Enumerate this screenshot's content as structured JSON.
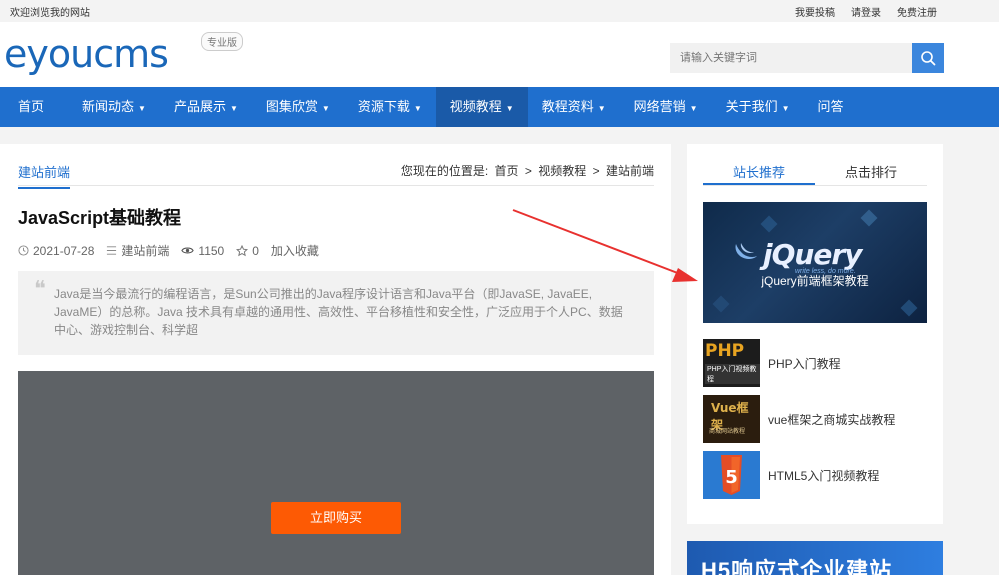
{
  "topbar": {
    "welcome": "欢迎浏览我的网站",
    "links": [
      "我要投稿",
      "请登录",
      "免费注册"
    ]
  },
  "header": {
    "logo_text": "eyoucms",
    "logo_badge": "专业版",
    "search_placeholder": "请输入关键字词"
  },
  "nav": {
    "items": [
      {
        "label": "首页",
        "caret": false,
        "active": false
      },
      {
        "label": "新闻动态",
        "caret": true,
        "active": false
      },
      {
        "label": "产品展示",
        "caret": true,
        "active": false
      },
      {
        "label": "图集欣赏",
        "caret": true,
        "active": false
      },
      {
        "label": "资源下载",
        "caret": true,
        "active": false
      },
      {
        "label": "视频教程",
        "caret": true,
        "active": true
      },
      {
        "label": "教程资料",
        "caret": true,
        "active": false
      },
      {
        "label": "网络营销",
        "caret": true,
        "active": false
      },
      {
        "label": "关于我们",
        "caret": true,
        "active": false
      },
      {
        "label": "问答",
        "caret": false,
        "active": false
      }
    ]
  },
  "article": {
    "category": "建站前端",
    "breadcrumb_prefix": "您现在的位置是:",
    "breadcrumb": [
      "首页",
      "视频教程",
      "建站前端"
    ],
    "title": "JavaScript基础教程",
    "date": "2021-07-28",
    "category_meta": "建站前端",
    "views": "1150",
    "stars": "0",
    "favorite": "加入收藏",
    "summary": "Java是当今最流行的编程语言，是Sun公司推出的Java程序设计语言和Java平台（即JavaSE, JavaEE, JavaME）的总称。Java 技术具有卓越的通用性、高效性、平台移植性和安全性，广泛应用于个人PC、数据中心、游戏控制台、科学超",
    "buy_button": "立即购买"
  },
  "sidebar": {
    "tabs": [
      "站长推荐",
      "点击排行"
    ],
    "feature": {
      "logo_word": "jQuery",
      "logo_sub": "write less, do more.",
      "caption": "jQuery前端框架教程"
    },
    "items": [
      {
        "label": "PHP入门教程",
        "thumb_text": "PHP",
        "thumb_sub": "PHP入门视频教程"
      },
      {
        "label": "vue框架之商城实战教程",
        "thumb_text": "Vue框架",
        "thumb_sub": "商城网站教程"
      },
      {
        "label": "HTML5入门视频教程",
        "thumb_text": "5"
      }
    ]
  },
  "banner": {
    "text": "H5响应式企业建站"
  },
  "colors": {
    "nav_bg": "#1f6fce",
    "nav_active": "#1a5aa8",
    "buy_button": "#fd5a04",
    "annotation_arrow": "#e8312f"
  }
}
